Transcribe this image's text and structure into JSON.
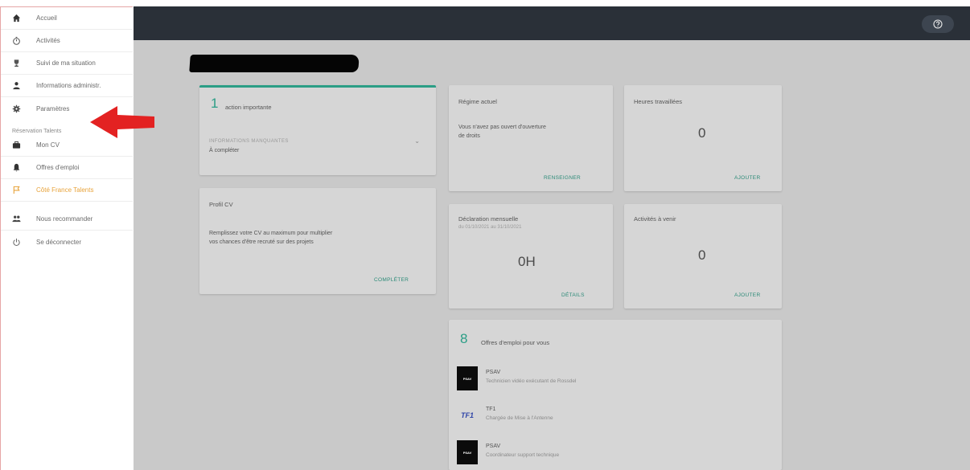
{
  "sidebar": {
    "items": [
      {
        "label": "Accueil",
        "icon": "home-icon"
      },
      {
        "label": "Activités",
        "icon": "timer-icon"
      },
      {
        "label": "Suivi de ma situation",
        "icon": "trophy-icon"
      },
      {
        "label": "Informations administr.",
        "icon": "person-icon"
      },
      {
        "label": "Paramètres",
        "icon": "gear-icon"
      }
    ],
    "section_title": "Réservation Talents",
    "section_items": [
      {
        "label": "Mon CV",
        "icon": "briefcase-icon"
      },
      {
        "label": "Offres d'emploi",
        "icon": "bell-icon"
      },
      {
        "label": "Côté France Talents",
        "icon": "flag-icon",
        "active": true
      }
    ],
    "bottom_items": [
      {
        "label": "Nous recommander",
        "icon": "group-icon"
      },
      {
        "label": "Se déconnecter",
        "icon": "power-icon"
      }
    ]
  },
  "colors": {
    "topbar": "#2a3038",
    "accent_green": "#2b9e86",
    "active_orange": "#e8a33b",
    "arrow_red": "#e32222"
  },
  "cards": {
    "actions": {
      "count": "1",
      "title": "action importante",
      "subtitle": "INFORMATIONS MANQUANTES",
      "detail": "À compléter"
    },
    "profile": {
      "title": "Profil CV",
      "text_line1": "Remplissez votre CV au maximum pour multiplier",
      "text_line2": "vos chances d'être recruté sur des projets",
      "link": "COMPLÉTER"
    },
    "regime": {
      "title": "Régime actuel",
      "text_line1": "Vous n'avez pas ouvert d'ouverture",
      "text_line2": "de droits",
      "link": "RENSEIGNER"
    },
    "hours": {
      "title": "Heures travaillées",
      "value": "0",
      "link": "AJOUTER"
    },
    "declaration": {
      "title": "Déclaration mensuelle",
      "subtitle": "du 01/10/2021 au 31/10/2021",
      "value": "0H",
      "link": "DÉTAILS"
    },
    "activities": {
      "title": "Activités à venir",
      "value": "0",
      "link": "AJOUTER"
    },
    "jobs": {
      "count": "8",
      "title": "Offres d'emploi pour vous",
      "items": [
        {
          "logo": "PSAV",
          "company": "PSAV",
          "desc": "Technicien vidéo exécutant de Rossdel"
        },
        {
          "logo": "TF1",
          "company": "TF1",
          "desc": "Chargée de Mise à l'Antenne"
        },
        {
          "logo": "PSAV",
          "company": "PSAV",
          "desc": "Coordinateur support technique"
        }
      ]
    }
  }
}
